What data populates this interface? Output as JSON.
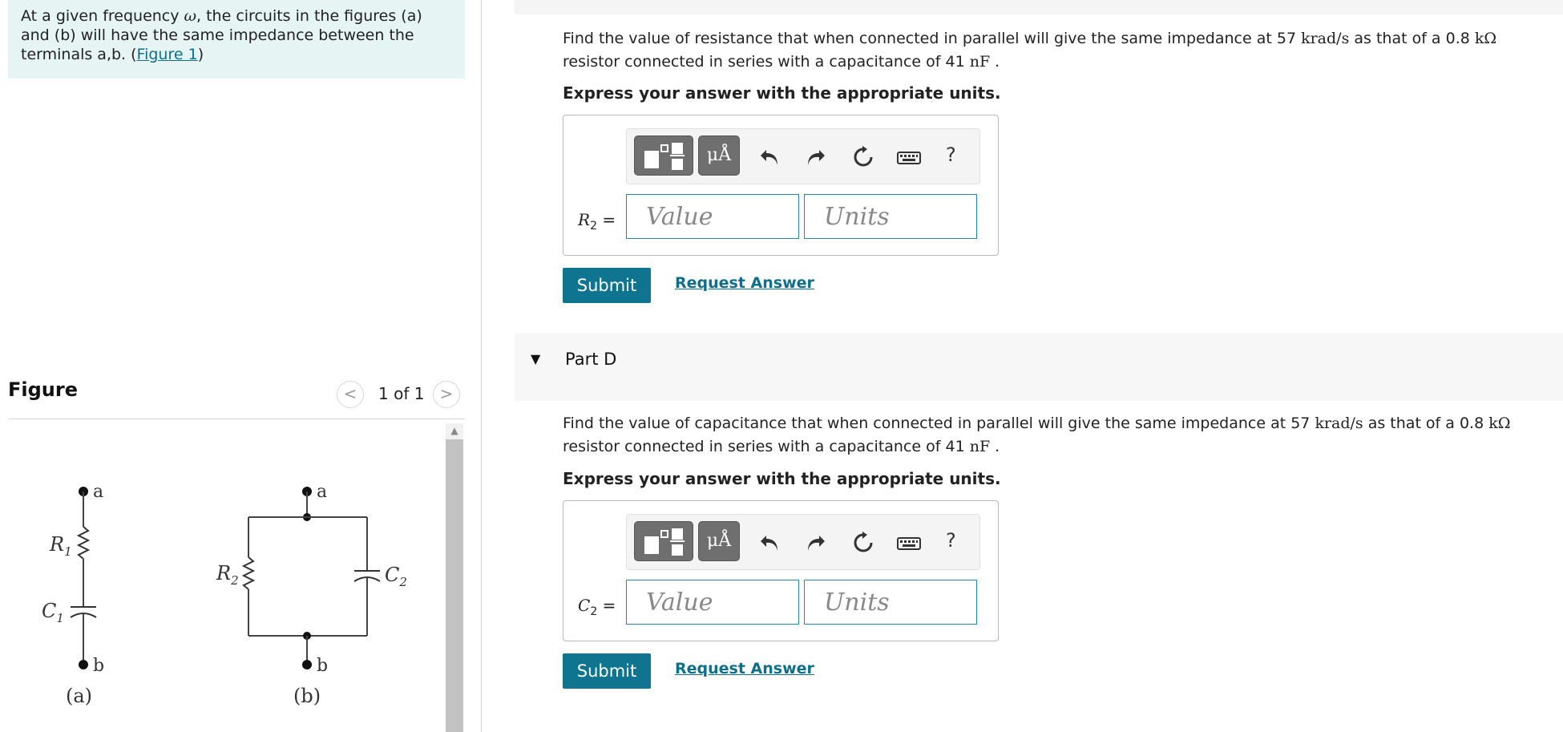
{
  "intro": {
    "text_before": "At a given frequency ",
    "omega": "ω",
    "text_after": ", the circuits in the figures (a) and (b) will have the same impedance between the terminals a,b. (",
    "figure_link": "Figure 1",
    "text_close": ")"
  },
  "figure": {
    "title": "Figure",
    "pager": {
      "prev": "<",
      "count": "1 of 1",
      "next": ">"
    },
    "circuit_labels": {
      "a_top": "a",
      "b_bottom": "b",
      "R1": "R",
      "R1_sub": "1",
      "C1": "C",
      "C1_sub": "1",
      "caption_a": "(a)",
      "a_top_b": "a",
      "b_bottom_b": "b",
      "R2": "R",
      "R2_sub": "2",
      "C2": "C",
      "C2_sub": "2",
      "caption_b": "(b)"
    }
  },
  "partC": {
    "q_1": "Find the value of resistance that when connected in parallel will give the same impedance at 57 ",
    "q_unit1": "krad/s",
    "q_2": " as that of a 0.8 ",
    "q_unit2": "kΩ",
    "q_3": " resistor connected in series with a capacitance of 41 ",
    "q_unit3": "nF",
    "q_4": " .",
    "instruction": "Express your answer with the appropriate units.",
    "var": "R",
    "var_sub": "2",
    "equals": "=",
    "value_placeholder": "Value",
    "units_placeholder": "Units",
    "toolbar_units": "μÅ",
    "help": "?",
    "submit": "Submit",
    "request": "Request Answer"
  },
  "partD": {
    "caret": "▼",
    "title": "Part D",
    "q_1": "Find the value of capacitance that when connected in parallel will give the same impedance at 57 ",
    "q_unit1": "krad/s",
    "q_2": " as that of a 0.8 ",
    "q_unit2": "kΩ",
    "q_3": " resistor connected in series with a capacitance of 41 ",
    "q_unit3": "nF",
    "q_4": " .",
    "instruction": "Express your answer with the appropriate units.",
    "var": "C",
    "var_sub": "2",
    "equals": "=",
    "value_placeholder": "Value",
    "units_placeholder": "Units",
    "toolbar_units": "μÅ",
    "help": "?",
    "submit": "Submit",
    "request": "Request Answer"
  },
  "colors": {
    "accent": "#0e7490",
    "link": "#0d6f8a",
    "intro_bg": "#e6f4f4",
    "input_border": "#1f8aa6"
  },
  "icons": [
    "template-icon",
    "units-icon",
    "undo-icon",
    "redo-icon",
    "reset-icon",
    "keyboard-icon",
    "help-icon",
    "chevron-left-icon",
    "chevron-right-icon",
    "caret-down-icon"
  ]
}
